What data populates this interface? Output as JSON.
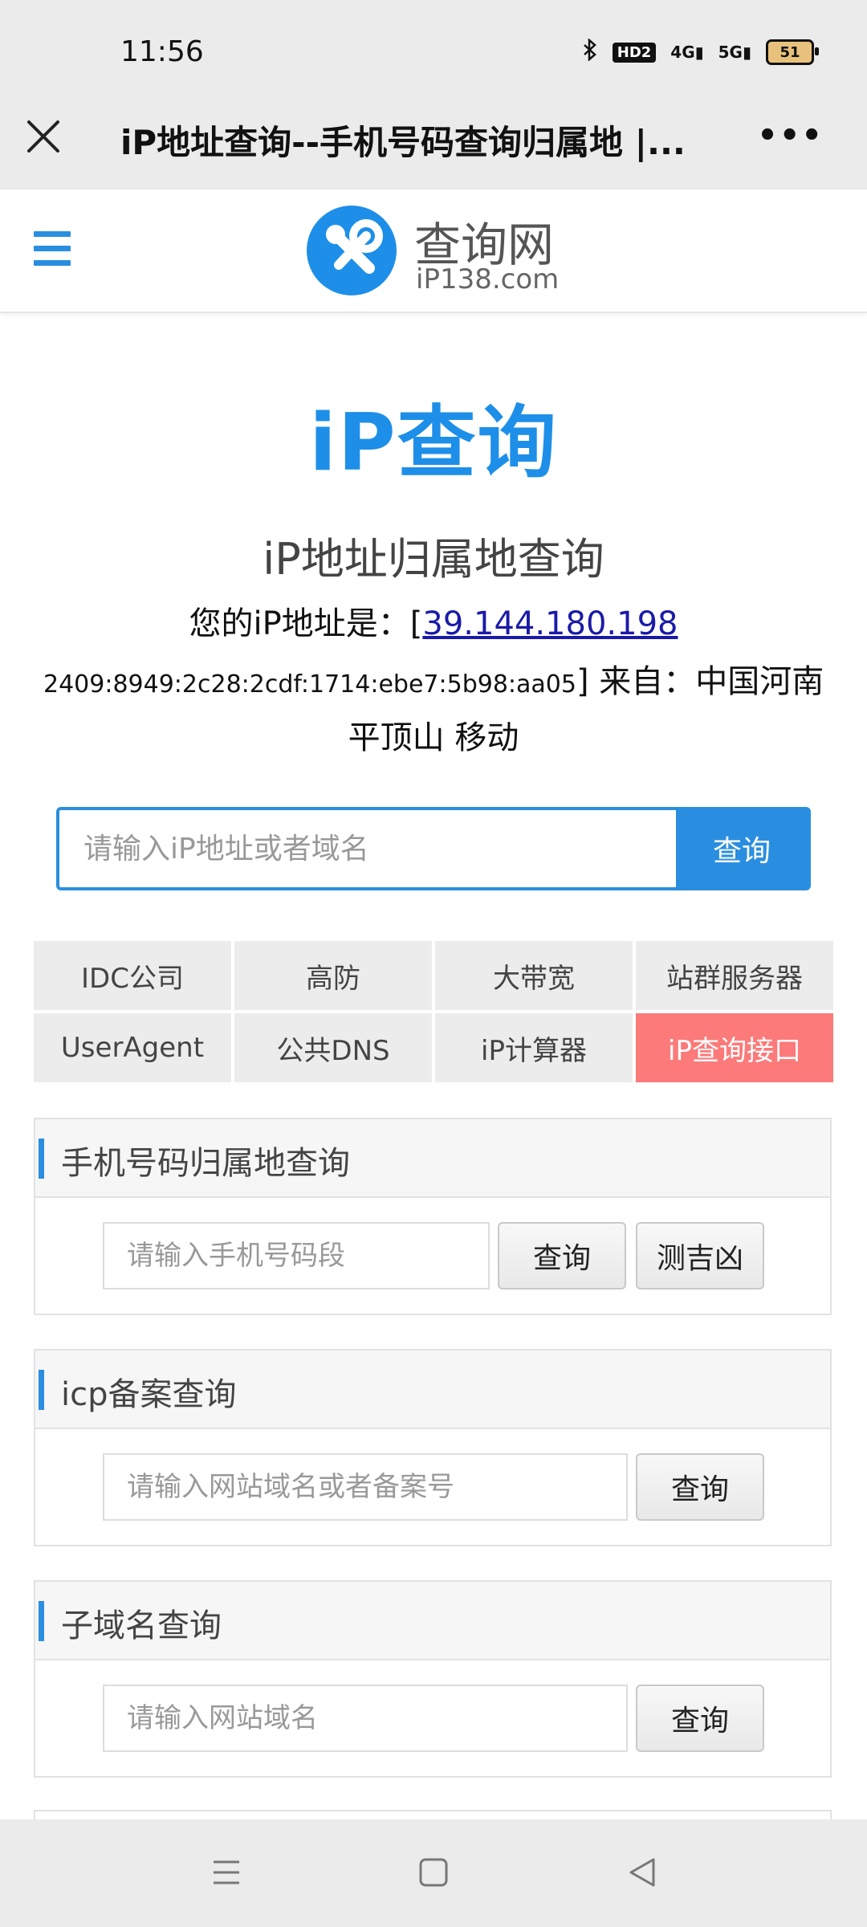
{
  "status": {
    "time": "11:56",
    "hd": "HD2",
    "net1": "4G",
    "net2": "5G",
    "battery": "51"
  },
  "browser": {
    "title": "iP地址查询--手机号码查询归属地 |..."
  },
  "site": {
    "logo_main": "查询网",
    "logo_sub": "iP138.com"
  },
  "hero": {
    "title": "iP查询",
    "subtitle": "iP地址归属地查询",
    "ip_prefix": "您的iP地址是：[",
    "ip_v4": "39.144.180.198",
    "ip_v6": "2409:8949:2c28:2cdf:1714:ebe7:5b98:aa05",
    "from": "] 来自：中国河南",
    "location": "平顶山 移动"
  },
  "main_search": {
    "placeholder": "请输入iP地址或者域名",
    "button": "查询"
  },
  "links": [
    "IDC公司",
    "高防",
    "大带宽",
    "站群服务器",
    "UserAgent",
    "公共DNS",
    "iP计算器",
    "iP查询接口"
  ],
  "panels": {
    "phone": {
      "title": "手机号码归属地查询",
      "placeholder": "请输入手机号码段",
      "button": "查询",
      "button2": "测吉凶"
    },
    "icp": {
      "title": "icp备案查询",
      "placeholder": "请输入网站域名或者备案号",
      "button": "查询"
    },
    "subdomain": {
      "title": "子域名查询",
      "placeholder": "请输入网站域名",
      "button": "查询"
    }
  }
}
